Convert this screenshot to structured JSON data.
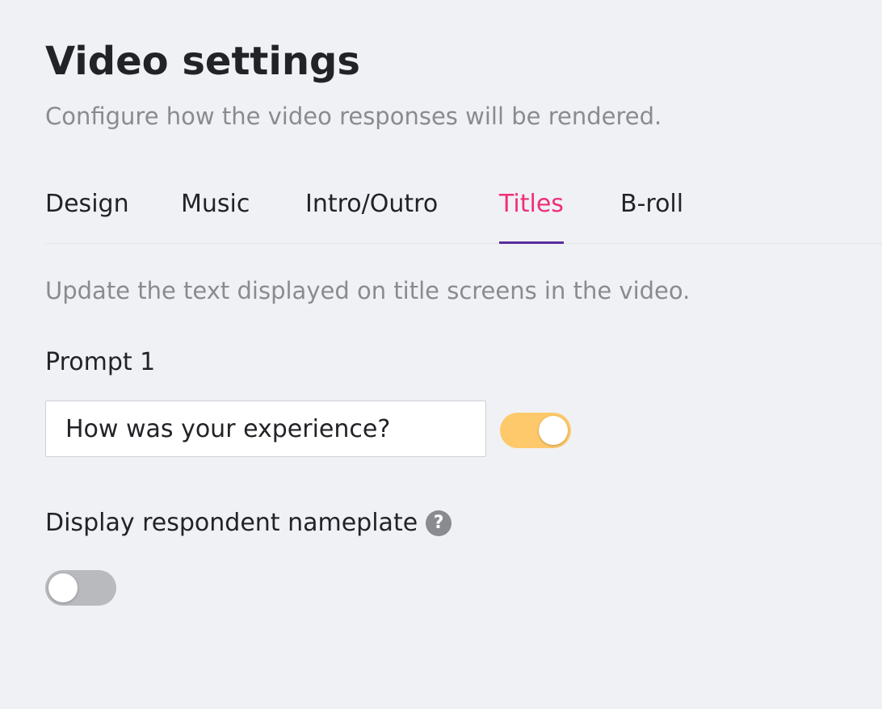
{
  "header": {
    "title": "Video settings",
    "subtitle": "Configure how the video responses will be rendered."
  },
  "tabs": [
    {
      "label": "Design",
      "active": false
    },
    {
      "label": "Music",
      "active": false
    },
    {
      "label": "Intro/Outro",
      "active": false
    },
    {
      "label": "Titles",
      "active": true
    },
    {
      "label": "B-roll",
      "active": false
    }
  ],
  "titles_panel": {
    "description": "Update the text displayed on title screens in the video.",
    "prompt": {
      "label": "Prompt 1",
      "value": "How was your experience?",
      "enabled": true
    },
    "nameplate": {
      "label": "Display respondent nameplate",
      "help_icon": "question-mark-icon",
      "help_glyph": "?",
      "enabled": false
    }
  },
  "colors": {
    "background": "#f0f1f5",
    "active_tab_text": "#ee2f7b",
    "active_tab_underline": "#5a2d9c",
    "toggle_on": "#fec96a",
    "toggle_off": "#b9babe",
    "muted_text": "#8a8b90"
  }
}
